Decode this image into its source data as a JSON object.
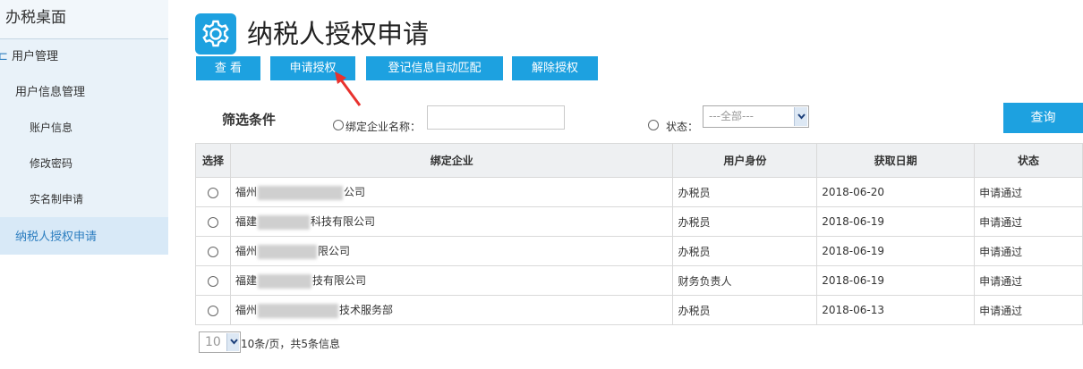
{
  "sidebar": {
    "title": "办税桌面",
    "group": "用户管理",
    "subgroup": "用户信息管理",
    "items": [
      "账户信息",
      "修改密码",
      "实名制申请"
    ],
    "active": "纳税人授权申请"
  },
  "header": {
    "title": "纳税人授权申请"
  },
  "toolbar": {
    "view": "查 看",
    "apply": "申请授权",
    "auto_match": "登记信息自动匹配",
    "revoke": "解除授权"
  },
  "filter": {
    "label": "筛选条件",
    "company_label": "绑定企业名称：",
    "company_value": "",
    "status_label": "状态：",
    "status_selected": "---全部---",
    "query": "查询"
  },
  "table": {
    "headers": [
      "选择",
      "绑定企业",
      "用户身份",
      "获取日期",
      "状态"
    ],
    "rows": [
      {
        "company_pre": "福州",
        "company_post": "公司",
        "role": "办税员",
        "date": "2018-06-20",
        "status": "申请通过"
      },
      {
        "company_pre": "福建",
        "company_post": "科技有限公司",
        "role": "办税员",
        "date": "2018-06-19",
        "status": "申请通过"
      },
      {
        "company_pre": "福州",
        "company_post": "限公司",
        "role": "办税员",
        "date": "2018-06-19",
        "status": "申请通过"
      },
      {
        "company_pre": "福建",
        "company_post": "技有限公司",
        "role": "财务负责人",
        "date": "2018-06-19",
        "status": "申请通过"
      },
      {
        "company_pre": "福州",
        "company_post": "技术服务部",
        "role": "办税员",
        "date": "2018-06-13",
        "status": "申请通过"
      }
    ]
  },
  "pager": {
    "page_size": "10",
    "summary": "10条/页，共5条信息"
  },
  "colors": {
    "accent": "#1da1e0",
    "annotation_arrow": "#e8322e"
  },
  "icons": {
    "logo": "gear-icon"
  }
}
